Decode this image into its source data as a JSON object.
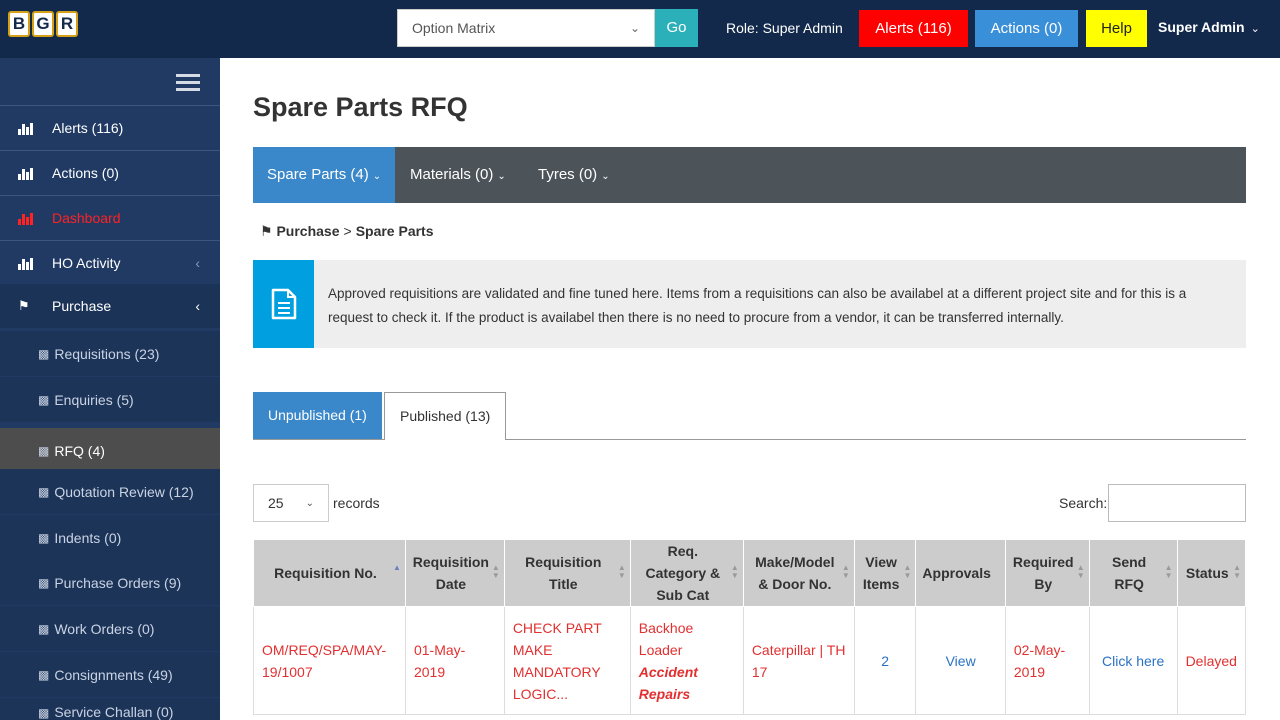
{
  "topbar": {
    "logo_letters": [
      "B",
      "G",
      "R"
    ],
    "matrix_select_value": "Option Matrix",
    "go_label": "Go",
    "role_text": "Role: Super Admin",
    "alerts_label": "Alerts (116)",
    "actions_label": "Actions (0)",
    "help_label": "Help",
    "user_label": "Super Admin"
  },
  "sidebar": {
    "items": [
      {
        "label": "Alerts (116)",
        "icon": "area-chart-icon"
      },
      {
        "label": "Actions (0)",
        "icon": "area-chart-icon"
      },
      {
        "label": "Dashboard",
        "icon": "area-chart-icon"
      },
      {
        "label": "HO Activity",
        "icon": "area-chart-icon"
      },
      {
        "label": "Purchase",
        "icon": "flag-icon"
      }
    ],
    "sub_items": [
      {
        "label": "Requisitions (23)"
      },
      {
        "label": "Enquiries (5)"
      },
      {
        "label": "RFQ (4)"
      },
      {
        "label": "Quotation Review (12)"
      },
      {
        "label": "Indents (0)"
      },
      {
        "label": "Purchase Orders (9)"
      },
      {
        "label": "Work Orders (0)"
      },
      {
        "label": "Consignments (49)"
      },
      {
        "label": "Service Challan (0)"
      }
    ]
  },
  "main": {
    "title": "Spare Parts RFQ",
    "tabs": [
      {
        "label": "Spare Parts (4)"
      },
      {
        "label": "Materials (0)"
      },
      {
        "label": "Tyres (0)"
      }
    ],
    "breadcrumb": {
      "parent": "Purchase",
      "separator": ">",
      "current": "Spare Parts"
    },
    "info_text": "Approved requisitions are validated and fine tuned here. Items from a requisitions can also be availabel at a different project site and for this is a request to check it. If the product is availabel then there is no need to procure from a vendor, it can be transferred internally.",
    "publish_tabs": [
      {
        "label": "Unpublished (1)"
      },
      {
        "label": "Published (13)"
      }
    ],
    "page_length": "25",
    "records_label": "records",
    "search_label": "Search:",
    "table": {
      "headers": [
        "Requisition No.",
        "Requisition Date",
        "Requisition Title",
        "Req. Category & Sub Cat",
        "Make/Model & Door No.",
        "View Items",
        "Approvals",
        "Required By",
        "Send RFQ",
        "Status"
      ],
      "rows": [
        {
          "req_no": "OM/REQ/SPA/MAY-19/1007",
          "req_date": "01-May-2019",
          "req_title": "CHECK PART MAKE MANDATORY LOGIC...",
          "category": "Backhoe Loader",
          "sub_category": "Accident Repairs",
          "make_model": "Caterpillar | TH 17",
          "view_items": "2",
          "approvals": "View",
          "required_by": "02-May-2019",
          "send_rfq": "Click here",
          "status": "Delayed"
        }
      ]
    }
  },
  "colors": {
    "topbar_bg": "#13294b",
    "sidebar_bg": "#213a63",
    "accent_blue": "#3a87c9",
    "alert_red": "#ff0000",
    "help_yellow": "#ffff00",
    "info_cyan": "#00a0e0",
    "go_teal": "#2bb0ba"
  }
}
